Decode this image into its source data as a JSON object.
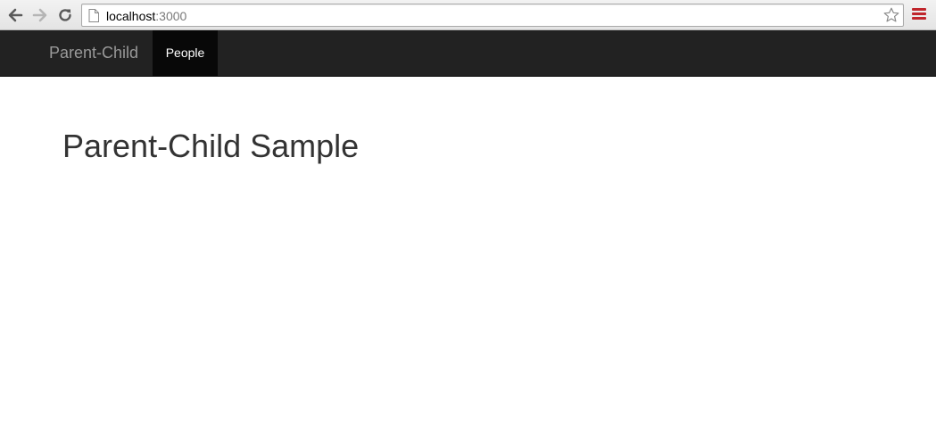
{
  "browser": {
    "url_host": "localhost",
    "url_port": ":3000",
    "icons": {
      "back": "back-arrow-icon",
      "forward": "forward-arrow-icon",
      "reload": "reload-icon",
      "page": "page-icon",
      "star": "star-icon",
      "menu": "menu-icon"
    },
    "menu_color": "#c0262c"
  },
  "navbar": {
    "brand": "Parent-Child",
    "items": [
      {
        "label": "People",
        "active": true
      }
    ],
    "background": "#222222",
    "active_background": "#080808"
  },
  "main": {
    "title": "Parent-Child Sample"
  }
}
